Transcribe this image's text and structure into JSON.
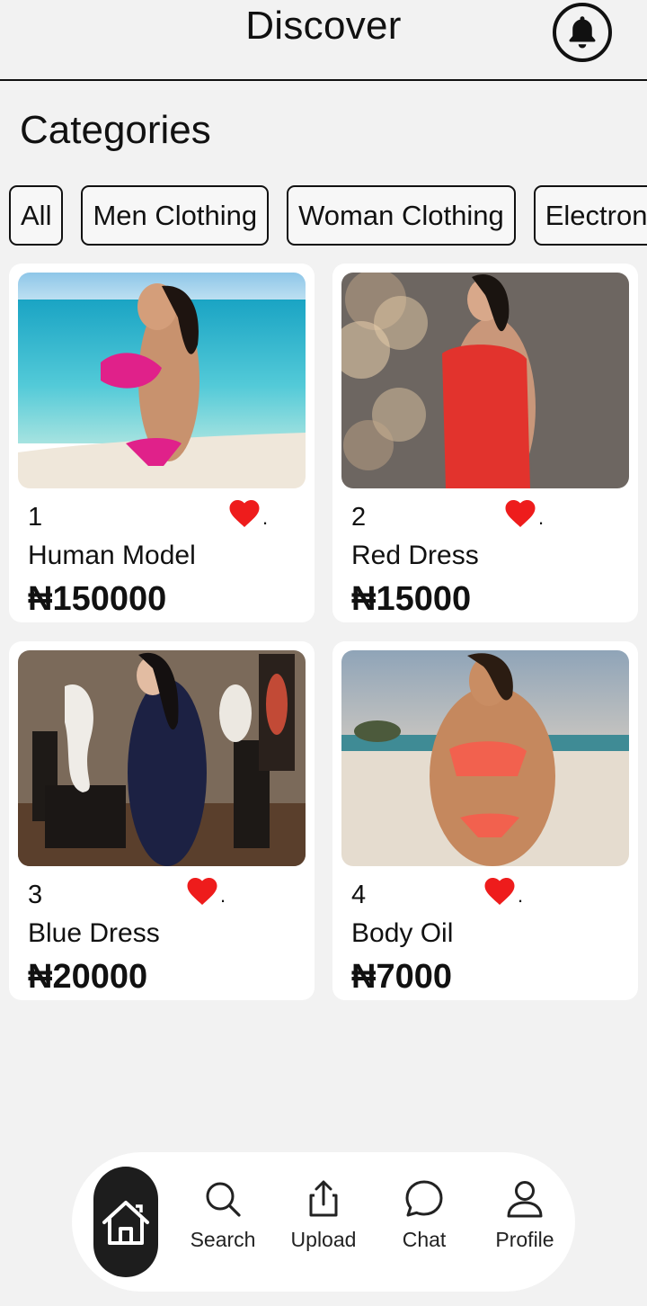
{
  "header": {
    "title": "Discover"
  },
  "categories": {
    "title": "Categories",
    "chips": [
      "All",
      "Men Clothing",
      "Woman Clothing",
      "Electronics"
    ]
  },
  "products": [
    {
      "number": "1",
      "name": "Human Model",
      "price": "₦150000",
      "heart_color": "#ee1c1c",
      "heart_icon": "heart-icon"
    },
    {
      "number": "2",
      "name": "Red Dress",
      "price": "₦15000",
      "heart_color": "#ee1c1c",
      "heart_icon": "heart-icon"
    },
    {
      "number": "3",
      "name": "Blue Dress",
      "price": "₦20000",
      "heart_color": "#ee1c1c",
      "heart_icon": "heart-icon"
    },
    {
      "number": "4",
      "name": "Body Oil",
      "price": "₦7000",
      "heart_color": "#ee1c1c",
      "heart_icon": "heart-icon"
    }
  ],
  "nav": {
    "home": {
      "icon": "home-icon"
    },
    "items": [
      {
        "label": "Search",
        "icon": "search-icon"
      },
      {
        "label": "Upload",
        "icon": "upload-icon"
      },
      {
        "label": "Chat",
        "icon": "chat-icon"
      },
      {
        "label": "Profile",
        "icon": "profile-icon"
      }
    ]
  },
  "colors": {
    "background": "#f2f2f2",
    "card": "#ffffff",
    "accent_dark": "#1d1d1d",
    "heart": "#ee1c1c"
  }
}
